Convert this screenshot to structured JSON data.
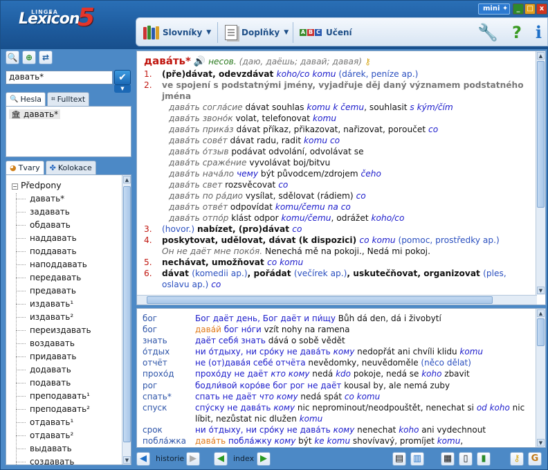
{
  "app": {
    "brand_small": "LINGEA",
    "brand": "Lexicon",
    "brand_num": "5",
    "mini_label": "mini",
    "min_btn": "_",
    "max_btn": "□",
    "close_btn": "x"
  },
  "toolbar": {
    "dictionaries": "Slovníky",
    "addons": "Doplňky",
    "learning": "Učení",
    "chev": "⌄"
  },
  "left": {
    "search_value": "давать*",
    "tab_entries": "Hesla",
    "tab_fulltext": "Fulltext",
    "result": "давать*",
    "tab_forms": "Tvary",
    "tab_collocations": "Kolokace",
    "tree_root": "Předpony",
    "tree_items": [
      "давать*",
      "задавать",
      "обдавать",
      "наддавать",
      "поддавать",
      "наподдавать",
      "передавать",
      "предавать",
      "издавать¹",
      "издавать²",
      "переиздавать",
      "воздавать",
      "придавать",
      "додавать",
      "подавать",
      "преподавать¹",
      "преподавать²",
      "отдавать¹",
      "отдавать²",
      "выдавать",
      "создавать"
    ]
  },
  "entry": {
    "headword": "дава́ть*",
    "aspect": "несов.",
    "forms": "(даю, даёшь; давай; давая)",
    "senses": [
      {
        "n": "1.",
        "parts": [
          [
            "b",
            "(pře)dávat, odevzdávat "
          ],
          [
            "i",
            "koho/co komu "
          ],
          [
            "g",
            "(dárek, peníze ap.)"
          ]
        ]
      },
      {
        "n": "2.",
        "parts": [
          [
            "bg",
            "ve spojení s podstatnými jmény, vyjadřuje děj daný významem podstatného jména"
          ]
        ]
      }
    ],
    "examples": [
      [
        [
          "ru",
          "дава́ть согла́сие "
        ],
        [
          "t",
          "dávat souhlas "
        ],
        [
          "i",
          "komu k čemu"
        ],
        [
          "t",
          ", souhlasit "
        ],
        [
          "i",
          "s kým/čím"
        ]
      ],
      [
        [
          "ru",
          "дава́ть звоно́к "
        ],
        [
          "t",
          "volat, telefonovat "
        ],
        [
          "i",
          "komu"
        ]
      ],
      [
        [
          "ru",
          "дава́ть прика́з "
        ],
        [
          "t",
          "dávat příkaz, přikazovat, nařizovat, porоučet "
        ],
        [
          "i",
          "co"
        ]
      ],
      [
        [
          "ru",
          "дава́ть сове́т "
        ],
        [
          "t",
          "dávat radu, radit "
        ],
        [
          "i",
          "komu co"
        ]
      ],
      [
        [
          "ru",
          "дава́ть о́тзыв "
        ],
        [
          "t",
          "podávat odvolání, odvolávat se"
        ]
      ],
      [
        [
          "ru",
          "дава́ть сраже́ние "
        ],
        [
          "t",
          "vyvolávat boj/bitvu"
        ]
      ],
      [
        [
          "ru",
          "дава́ть нача́ло "
        ],
        [
          "i",
          "чему "
        ],
        [
          "t",
          "být původcem/zdrojem "
        ],
        [
          "i",
          "čeho"
        ]
      ],
      [
        [
          "ru",
          "дава́ть свет "
        ],
        [
          "t",
          "rozsvěcovat "
        ],
        [
          "i",
          "co"
        ]
      ],
      [
        [
          "ru",
          "дава́ть по ра́дио "
        ],
        [
          "t",
          "vysílat, sdělovat (rádiem) "
        ],
        [
          "i",
          "co"
        ]
      ],
      [
        [
          "ru",
          "дава́ть отве́т "
        ],
        [
          "t",
          "odpovídat "
        ],
        [
          "i",
          "komu/čemu na co"
        ]
      ],
      [
        [
          "ru",
          "дава́ть отпо́р "
        ],
        [
          "t",
          "klást odpor "
        ],
        [
          "i",
          "komu/čemu"
        ],
        [
          "t",
          ", odrážet "
        ],
        [
          "i",
          "koho/co"
        ]
      ]
    ],
    "senses2": [
      {
        "n": "3.",
        "parts": [
          [
            "c",
            "(hovor.) "
          ],
          [
            "b",
            "nabízet, (pro)dávat "
          ],
          [
            "i",
            "co"
          ]
        ]
      },
      {
        "n": "4.",
        "parts": [
          [
            "b",
            "poskytovat, udělovat, dávat (k dispozici) "
          ],
          [
            "i",
            "co komu "
          ],
          [
            "c",
            "(pomoc, prostředky ap.)"
          ]
        ]
      },
      {
        "n": "",
        "parts": [
          [
            "ru",
            "Он не даёт мне поко́я. "
          ],
          [
            "t",
            "Nenechá mě na pokoji., Nedá mi pokoj."
          ]
        ]
      },
      {
        "n": "5.",
        "parts": [
          [
            "b",
            "nechávat, umožňovat "
          ],
          [
            "i",
            "co komu"
          ]
        ]
      },
      {
        "n": "6.",
        "parts": [
          [
            "b",
            "dávat "
          ],
          [
            "c",
            "(komedii ap.)"
          ],
          [
            "b",
            ", pořádat "
          ],
          [
            "c",
            "(večírek ap.)"
          ],
          [
            "b",
            ", uskutečňovat, organizovat "
          ],
          [
            "c",
            "(ples, oslavu ap.) "
          ],
          [
            "i",
            "co"
          ]
        ]
      }
    ]
  },
  "collocations": [
    {
      "k": "бог",
      "v": [
        [
          "b",
          "Бог даёт день, Бог даёт и пи́щу "
        ],
        [
          "t",
          "Bůh dá den, dá i živobytí"
        ]
      ]
    },
    {
      "k": "бог",
      "v": [
        [
          "o",
          "дава́й "
        ],
        [
          "b",
          "бог но́ги "
        ],
        [
          "t",
          "vzít nohy na ramena"
        ]
      ]
    },
    {
      "k": "знать",
      "v": [
        [
          "b",
          "даёт себя́ знать "
        ],
        [
          "t",
          "dává o sobě vědět"
        ]
      ]
    },
    {
      "k": "о́тдых",
      "v": [
        [
          "b",
          "ни о́тдыху, ни сро́ку не дава́ть "
        ],
        [
          "i",
          "кому "
        ],
        [
          "t",
          "nedopřát ani chvíli klidu "
        ],
        [
          "i",
          "komu"
        ]
      ]
    },
    {
      "k": "отчёт",
      "v": [
        [
          "b",
          "не (от)дава́я себе́ отчёта "
        ],
        [
          "t",
          "nevědomky, neuvědoměle "
        ],
        [
          "c",
          "(něco dělat)"
        ]
      ]
    },
    {
      "k": "прохо́д",
      "v": [
        [
          "b",
          "прохо́ду не даёт "
        ],
        [
          "i",
          "кто кому "
        ],
        [
          "t",
          "nedá "
        ],
        [
          "i",
          "kdo "
        ],
        [
          "t",
          "pokoje, nedá se "
        ],
        [
          "i",
          "koho "
        ],
        [
          "t",
          "zbavit"
        ]
      ]
    },
    {
      "k": "рог",
      "v": [
        [
          "b",
          "бодли́вой коро́ве бог рог не даёт "
        ],
        [
          "t",
          "kousal by, ale nemá zuby"
        ]
      ]
    },
    {
      "k": "спать*",
      "v": [
        [
          "b",
          "спать не даёт "
        ],
        [
          "i",
          "что кому "
        ],
        [
          "t",
          "nedá spát "
        ],
        [
          "i",
          "co komu"
        ]
      ]
    },
    {
      "k": "спуск",
      "v": [
        [
          "b",
          "спу́ску не дава́ть "
        ],
        [
          "i",
          "кому "
        ],
        [
          "t",
          "nic neprominout/neodpouštět, nenechat si "
        ],
        [
          "i",
          "od koho "
        ],
        [
          "t",
          "nic líbit, nezůstat nic dlužen "
        ],
        [
          "i",
          "komu"
        ]
      ]
    },
    {
      "k": "срок",
      "v": [
        [
          "b",
          "ни о́тдыху, ни сро́ку не дава́ть "
        ],
        [
          "i",
          "кому "
        ],
        [
          "t",
          "nenechat "
        ],
        [
          "i",
          "koho "
        ],
        [
          "t",
          "ani vydechnout"
        ]
      ]
    },
    {
      "k": "побла́жка",
      "v": [
        [
          "o",
          "дава́ть "
        ],
        [
          "b",
          "побла́жку "
        ],
        [
          "i",
          "кому "
        ],
        [
          "t",
          "být "
        ],
        [
          "i",
          "ke komu "
        ],
        [
          "t",
          "shovívavý, promíjet "
        ],
        [
          "i",
          "komu"
        ],
        [
          "t",
          ","
        ]
      ]
    }
  ],
  "nav": {
    "history": "historie",
    "index": "index"
  },
  "colors": {
    "accent": "#c0160f",
    "link": "#1a1acb",
    "brand_red": "#e3352b"
  }
}
